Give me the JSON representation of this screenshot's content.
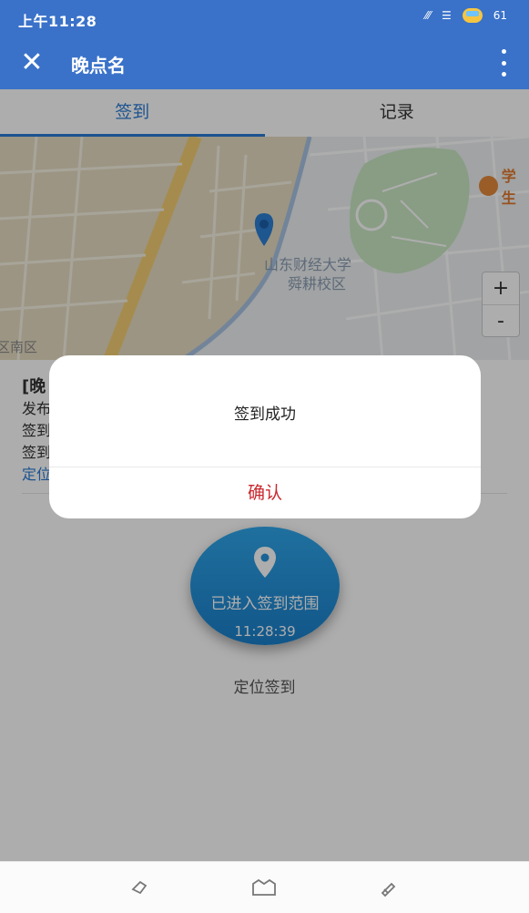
{
  "status_bar": {
    "time": "上午11:28",
    "battery": "61"
  },
  "app_bar": {
    "title": "晚点名"
  },
  "tabs": [
    {
      "label": "签到",
      "active": true
    },
    {
      "label": "记录",
      "active": false
    }
  ],
  "map": {
    "label_campus_1": "山东财经大学",
    "label_campus_2": "舜耕校区",
    "label_district": "区南区",
    "poi": "学生",
    "zoom_in": "+",
    "zoom_out": "-"
  },
  "info": {
    "name_partial": "[晚",
    "line1_partial": "发布",
    "line2_partial": "签到",
    "line3_partial": "签到",
    "location_partial": "定位"
  },
  "checkin": {
    "status": "已进入签到范围",
    "time": "11:28:39",
    "caption": "定位签到"
  },
  "dialog": {
    "message": "签到成功",
    "confirm": "确认"
  },
  "colors": {
    "primary": "#3a72c9",
    "accent": "#2a7bd3",
    "confirm": "#c8282e"
  }
}
